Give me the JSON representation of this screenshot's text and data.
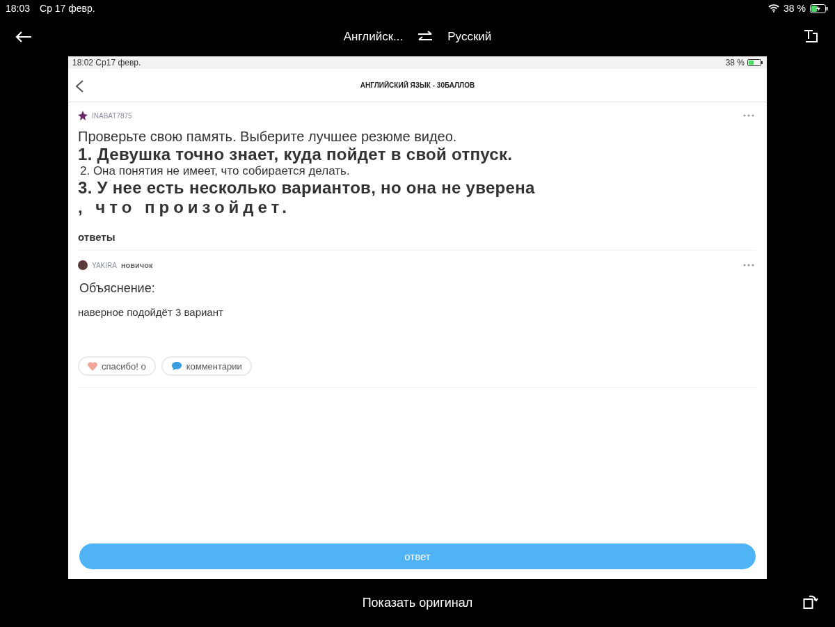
{
  "status_bar": {
    "time": "18:03",
    "date": "Ср 17 февр.",
    "battery": "38 %"
  },
  "toolbar": {
    "source_language": "Английск...",
    "target_language": "Русский"
  },
  "screenshot": {
    "status_bar": {
      "time_date": "18:02 Ср17 февр.",
      "battery": "38 %"
    },
    "header": {
      "title": "АНГЛИЙСКИЙ ЯЗЫК - 30БАЛЛОВ"
    },
    "question": {
      "author": "INABAT7875",
      "lines": [
        {
          "kind": "lead",
          "text": "Проверьте свою память. Выберите лучшее резюме видео."
        },
        {
          "kind": "large",
          "text": "1. Девушка точно знает, куда пойдет в свой отпуск."
        },
        {
          "kind": "small",
          "text": "2. Она понятия не имеет, что собирается делать."
        },
        {
          "kind": "large",
          "text": "3. У нее есть несколько вариантов, но она не уверена"
        },
        {
          "kind": "spaced",
          "text": ", что произойдет."
        }
      ],
      "answers_label": "ответы"
    },
    "answer": {
      "author": "YAKIRA",
      "rank": "новичок",
      "heading": "Объяснение:",
      "body": "наверное подойдёт 3 вариант",
      "thanks_button": "спасибо! о",
      "comments_button": "комментарии"
    },
    "answer_button": "ответ"
  },
  "bottom_bar": {
    "show_original": "Показать оригинал"
  }
}
